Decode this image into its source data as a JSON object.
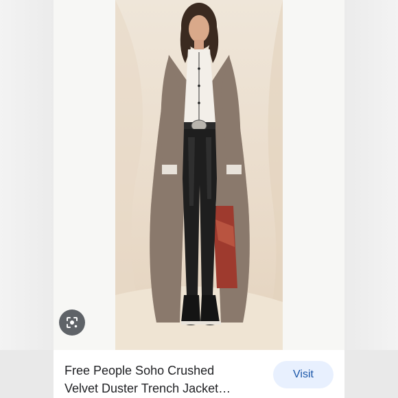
{
  "listing": {
    "title_line1": "Free People Soho Crushed",
    "title_line2": "Velvet Duster Trench Jacket…",
    "visit_label": "Visit"
  },
  "icons": {
    "lens": "google-lens-icon"
  },
  "colors": {
    "visit_bg": "#e8f0fe",
    "visit_text": "#1a56a8",
    "lens_bg": "#5f6368",
    "title_text": "#202124"
  }
}
